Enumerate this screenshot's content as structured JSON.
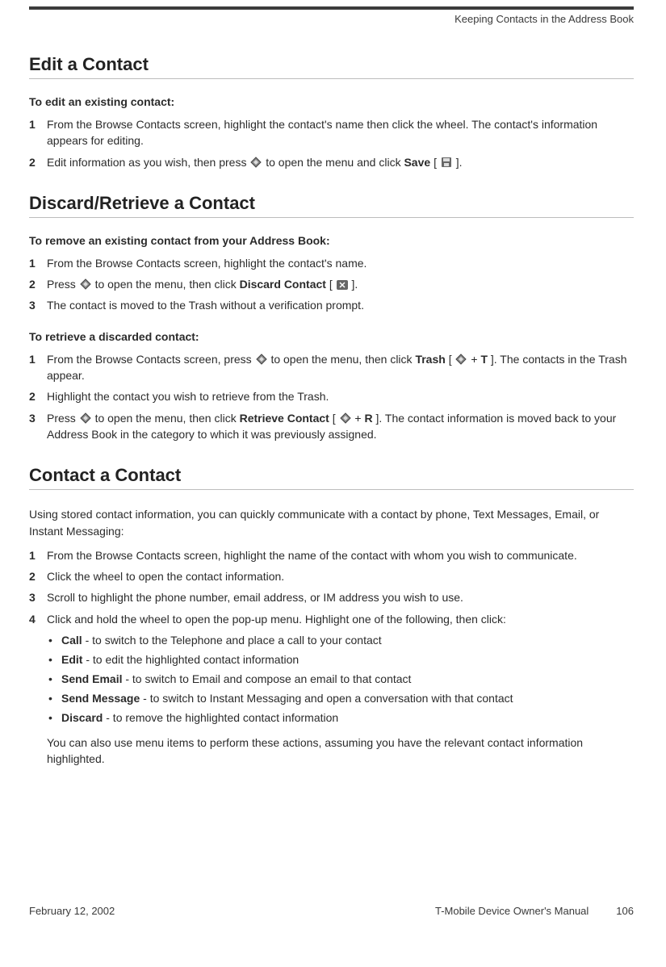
{
  "header": {
    "chapter": "Keeping Contacts in the Address Book"
  },
  "sections": {
    "edit": {
      "title": "Edit a Contact",
      "sub": "To edit an existing contact:",
      "s1": "From the Browse Contacts screen, highlight the contact's name then click the wheel. The contact's information appears for editing.",
      "s2a": "Edit information as you wish, then press ",
      "s2b": " to open the menu and click ",
      "s2_save": "Save",
      "s2c": " [ ",
      "s2d": " ]."
    },
    "discard": {
      "title": "Discard/Retrieve a Contact",
      "sub1": "To remove an existing contact from your Address Book:",
      "d1": "From the Browse Contacts screen, highlight the contact's name.",
      "d2a": "Press ",
      "d2b": " to open the menu, then click ",
      "d2_discard": "Discard Contact",
      "d2c": " [",
      "d2d": "].",
      "d3": "The contact is moved to the Trash without a verification prompt.",
      "sub2": "To retrieve a discarded contact:",
      "r1a": "From the Browse Contacts screen, press ",
      "r1b": " to open the menu, then click ",
      "r1_trash": "Trash",
      "r1c": " [ ",
      "r1d": " + ",
      "r1_t": "T",
      "r1e": "]. The contacts in the Trash appear.",
      "r2": "Highlight the contact you wish to retrieve from the Trash.",
      "r3a": "Press ",
      "r3b": " to open the menu, then click ",
      "r3_ret": "Retrieve Contact",
      "r3c": " [ ",
      "r3d": " + ",
      "r3_r": "R",
      "r3e": "]. The contact information is moved back to your Address Book in the category to which it was previously assigned."
    },
    "contact": {
      "title": "Contact a Contact",
      "intro": "Using stored contact information, you can quickly communicate with a contact by phone, Text Messages, Email, or Instant Messaging:",
      "c1": "From the Browse Contacts screen, highlight the name of the contact with whom you wish to communicate.",
      "c2": "Click the wheel to open the contact information.",
      "c3": "Scroll to highlight the phone number, email address, or IM address you wish to use.",
      "c4": "Click and hold the wheel to open the pop-up menu. Highlight one of the following, then click:",
      "b_call_l": "Call",
      "b_call_t": " - to switch to the Telephone and place a call to your contact",
      "b_edit_l": "Edit",
      "b_edit_t": " - to edit the highlighted contact information",
      "b_sem_l": "Send Email",
      "b_sem_t": " - to switch to Email and compose an email to that contact",
      "b_smsg_l": "Send Message",
      "b_smsg_t": " - to switch to Instant Messaging and open a conversation with that contact",
      "b_dis_l": "Discard",
      "b_dis_t": " - to remove the highlighted contact information",
      "note": "You can also use menu items to perform these actions, assuming you have the relevant contact information highlighted."
    }
  },
  "footer": {
    "date": "February 12, 2002",
    "manual": "T-Mobile Device Owner's Manual",
    "page": "106"
  }
}
